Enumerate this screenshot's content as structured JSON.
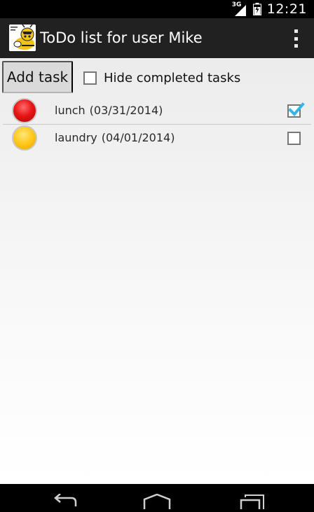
{
  "status_bar": {
    "network_label": "3G",
    "time": "12:21"
  },
  "action_bar": {
    "title": "ToDo list for user Mike",
    "app_icon": "bee-logo-icon",
    "menu_icon": "overflow-menu-icon"
  },
  "toolbar": {
    "add_task_label": "Add task",
    "hide_completed_label": "Hide completed tasks",
    "hide_completed_checked": false
  },
  "tasks": [
    {
      "name": "lunch",
      "date": "(03/31/2014)",
      "priority": "red",
      "priority_color": "#e81717",
      "completed": true
    },
    {
      "name": "laundry",
      "date": "(04/01/2014)",
      "priority": "yellow",
      "priority_color": "#ffc719",
      "completed": false
    }
  ],
  "nav_bar": {
    "buttons": [
      "back-icon",
      "home-icon",
      "recent-apps-icon"
    ]
  },
  "colors": {
    "action_bar": "#212121",
    "check_accent": "#33b5e5"
  }
}
